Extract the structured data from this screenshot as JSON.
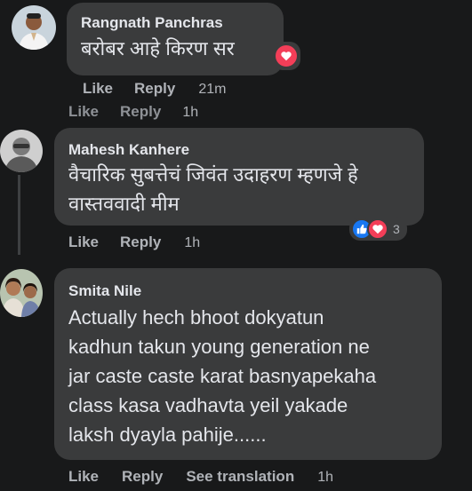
{
  "comments": [
    {
      "author": "Rangnath Panchras",
      "text_lines": [
        "बरोबर आहे किरण सर"
      ],
      "actions": {
        "like": "Like",
        "reply": "Reply",
        "time": "21m"
      }
    },
    {
      "author": "Mahesh Kanhere",
      "text_lines": [
        "वैचारिक सुबत्तेचं जिवंत उदाहरण म्हणजे हे",
        "वास्तववादी मीम"
      ],
      "actions": {
        "like": "Like",
        "reply": "Reply",
        "time": "1h"
      },
      "reaction_count": "3"
    },
    {
      "author": "Smita Nile",
      "text_lines": [
        "Actually hech bhoot dokyatun",
        "kadhun takun young generation ne",
        "jar caste caste karat basnyapekaha",
        "class kasa vadhavta yeil yakade",
        "laksh dyayla pahije......"
      ],
      "actions": {
        "like": "Like",
        "reply": "Reply",
        "translate": "See translation",
        "time": "1h"
      }
    }
  ],
  "overlapped_row": {
    "like": "Like",
    "reply": "Reply",
    "time": "1h"
  },
  "colors": {
    "background": "#18191a",
    "bubble": "#3a3b3c",
    "text": "#e4e6eb",
    "secondary_text": "#b0b3b8",
    "love_reaction": "#f33e58",
    "like_reaction": "#1877f2"
  },
  "icons": [
    "love-reaction-icon",
    "like-reaction-icon"
  ]
}
